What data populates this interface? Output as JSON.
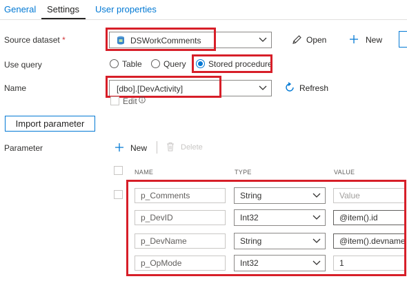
{
  "tabs": [
    {
      "label": "General"
    },
    {
      "label": "Settings"
    },
    {
      "label": "User properties"
    }
  ],
  "source_dataset": {
    "label": "Source dataset",
    "required_mark": "*",
    "value": "DSWorkComments",
    "open_label": "Open",
    "new_label": "New"
  },
  "use_query": {
    "label": "Use query",
    "options": [
      {
        "label": "Table"
      },
      {
        "label": "Query"
      },
      {
        "label": "Stored procedure"
      }
    ],
    "selected": "Stored procedure"
  },
  "name": {
    "label": "Name",
    "value": "[dbo].[DevActivity]",
    "refresh_label": "Refresh",
    "edit_label": "Edit"
  },
  "import_button": "Import parameter",
  "parameter": {
    "label": "Parameter",
    "new_label": "New",
    "delete_label": "Delete",
    "columns": [
      "NAME",
      "TYPE",
      "VALUE"
    ],
    "rows": [
      {
        "name": "p_Comments",
        "type": "String",
        "value": "",
        "placeholder": "Value"
      },
      {
        "name": "p_DevID",
        "type": "Int32",
        "value": "@item().id",
        "placeholder": ""
      },
      {
        "name": "p_DevName",
        "type": "String",
        "value": "@item().devname",
        "placeholder": ""
      },
      {
        "name": "p_OpMode",
        "type": "Int32",
        "value": "1",
        "placeholder": ""
      }
    ]
  },
  "colors": {
    "accent": "#0078d4",
    "highlight": "#d71e28"
  }
}
